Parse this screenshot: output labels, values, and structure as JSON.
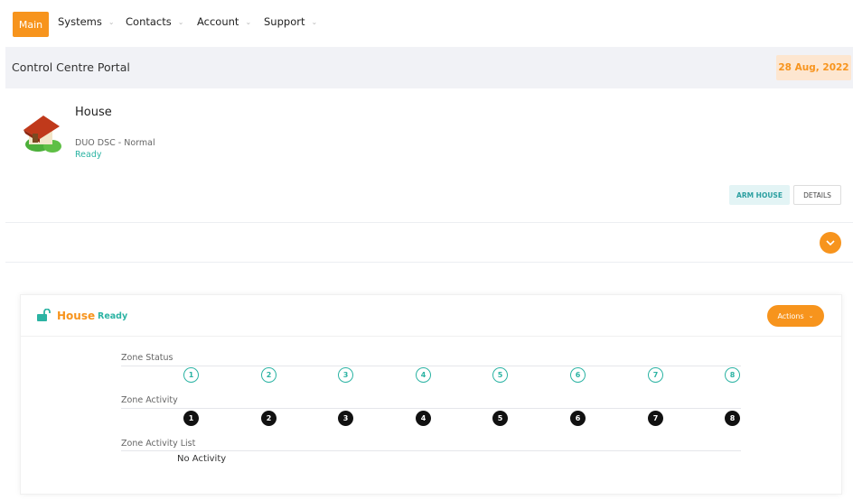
{
  "nav": {
    "main": "Main",
    "items": [
      "Systems",
      "Contacts",
      "Account",
      "Support"
    ]
  },
  "header": {
    "title": "Control Centre Portal",
    "date": "28 Aug, 2022"
  },
  "system": {
    "name": "House",
    "type": "DUO DSC - Normal",
    "status": "Ready",
    "arm_label": "ARM HOUSE",
    "details_label": "DETAILS"
  },
  "panel": {
    "title": "House",
    "status": "Ready",
    "actions_label": "Actions",
    "zone_status_label": "Zone Status",
    "zone_activity_label": "Zone Activity",
    "zone_activity_list_label": "Zone Activity List",
    "no_activity": "No Activity",
    "zones": [
      "1",
      "2",
      "3",
      "4",
      "5",
      "6",
      "7",
      "8"
    ]
  },
  "colors": {
    "accent": "#f7941d",
    "ready": "#2bb3a3"
  }
}
